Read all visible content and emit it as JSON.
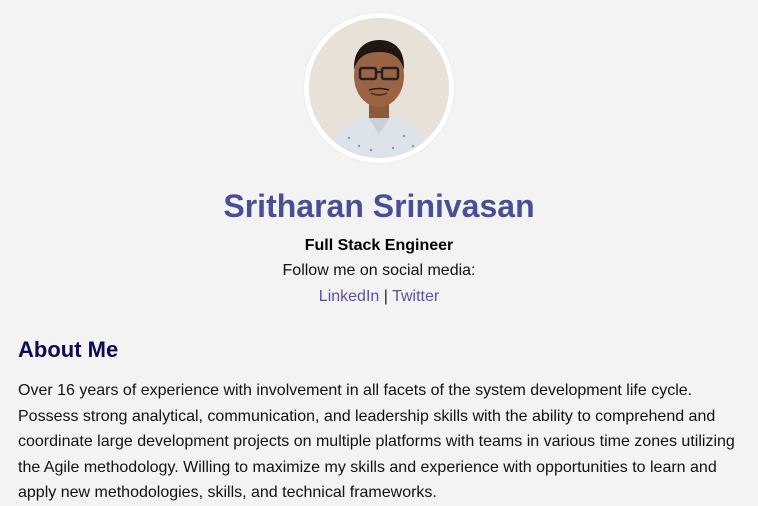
{
  "profile": {
    "name": "Sritharan Srinivasan",
    "title": "Full Stack Engineer",
    "follow_text": "Follow me on social media:",
    "links": {
      "linkedin": "LinkedIn",
      "separator": "|",
      "twitter": "Twitter"
    }
  },
  "about": {
    "heading": "About Me",
    "text": "Over 16 years of experience with involvement in all facets of the system development life cycle. Possess strong analytical, communication, and leadership skills with the ability to comprehend and coordinate large development projects on multiple platforms with teams in various time zones utilizing the Agile methodology. Willing to maximize my skills and experience with opportunities to learn and apply new methodologies, skills, and technical frameworks."
  },
  "colors": {
    "background": "#f3f3f3",
    "name": "#4a4f95",
    "heading": "#0c0a55",
    "link": "#5b4fa8"
  }
}
